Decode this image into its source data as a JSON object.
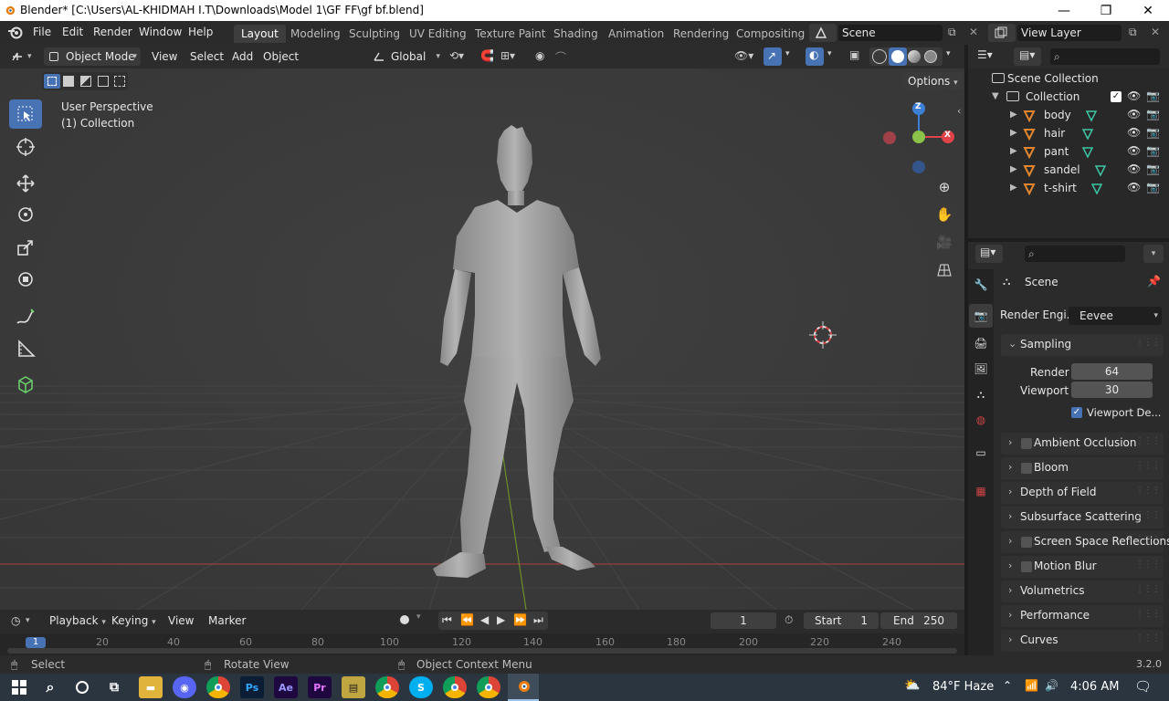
{
  "window": {
    "title": "Blender* [C:\\Users\\AL-KHIDMAH I.T\\Downloads\\Model 1\\GF FF\\gf bf.blend]"
  },
  "topbar": {
    "menus": [
      "File",
      "Edit",
      "Render",
      "Window",
      "Help"
    ],
    "workspaces": [
      "Layout",
      "Modeling",
      "Sculpting",
      "UV Editing",
      "Texture Paint",
      "Shading",
      "Animation",
      "Rendering",
      "Compositing"
    ],
    "scene": "Scene",
    "view_layer": "View Layer"
  },
  "viewport": {
    "mode": "Object Mode",
    "menus": [
      "View",
      "Select",
      "Add",
      "Object"
    ],
    "transform": "Global",
    "options": "Options",
    "info_line1": "User Perspective",
    "info_line2": "(1) Collection",
    "gizmo": {
      "x": "X",
      "y": "Y",
      "z": "Z"
    }
  },
  "timeline": {
    "menus": [
      "Playback",
      "Keying",
      "View",
      "Marker"
    ],
    "current_frame": "1",
    "start_label": "Start",
    "start": "1",
    "end_label": "End",
    "end": "250",
    "ruler": [
      "1",
      "20",
      "40",
      "60",
      "80",
      "100",
      "120",
      "140",
      "160",
      "180",
      "200",
      "220",
      "240"
    ]
  },
  "outliner": {
    "root": "Scene Collection",
    "collection": "Collection",
    "objects": [
      "body",
      "hair",
      "pant",
      "sandel",
      "t-shirt"
    ]
  },
  "properties": {
    "title": "Scene",
    "render_engine_label": "Render Engi...",
    "render_engine": "Eevee",
    "sampling": "Sampling",
    "render_label": "Render",
    "render_value": "64",
    "viewport_label": "Viewport",
    "viewport_value": "30",
    "viewport_denoise": "Viewport De...",
    "sections": [
      {
        "label": "Ambient Occlusion",
        "checkbox": true
      },
      {
        "label": "Bloom",
        "checkbox": true
      },
      {
        "label": "Depth of Field",
        "checkbox": false
      },
      {
        "label": "Subsurface Scattering",
        "checkbox": false
      },
      {
        "label": "Screen Space Reflections",
        "checkbox": true
      },
      {
        "label": "Motion Blur",
        "checkbox": true
      },
      {
        "label": "Volumetrics",
        "checkbox": false
      },
      {
        "label": "Performance",
        "checkbox": false
      },
      {
        "label": "Curves",
        "checkbox": false
      }
    ]
  },
  "statusbar": {
    "select": "Select",
    "rotate": "Rotate View",
    "context": "Object Context Menu",
    "version": "3.2.0"
  },
  "taskbar": {
    "weather": "84°F  Haze",
    "time": "4:06 AM"
  },
  "colors": {
    "accent": "#4772b3",
    "active_ws": "#3d3d3d",
    "x_axis": "#e0434a",
    "y_axis": "#8bc34a",
    "z_axis": "#3d7fd5",
    "object_icon": "#e3872f"
  }
}
